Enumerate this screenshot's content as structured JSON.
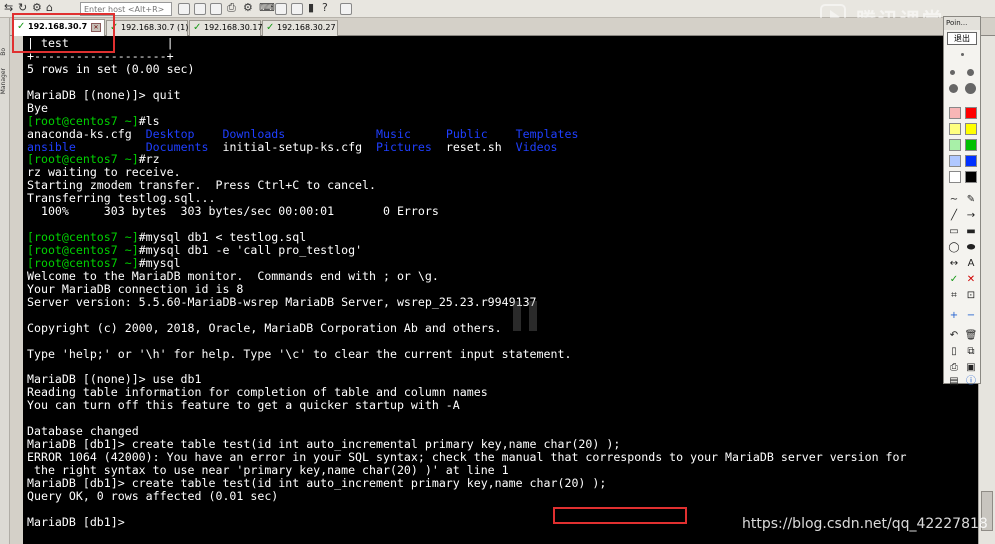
{
  "toolbar": {
    "host_placeholder": "Enter host <Alt+R>"
  },
  "left_strip": {
    "labels": [
      "Bo",
      "Manager"
    ]
  },
  "tabs": [
    {
      "label": "192.168.30.7",
      "active": true
    },
    {
      "label": "192.168.30.7 (1)",
      "active": false
    },
    {
      "label": "192.168.30.17",
      "active": false
    },
    {
      "label": "192.168.30.27",
      "active": false
    }
  ],
  "toolbox": {
    "title": "Poin...",
    "exit_label": "退出"
  },
  "watermark": {
    "brand": "腾讯课堂",
    "url": "https://blog.csdn.net/qq_42227818"
  },
  "terminal": {
    "lines": [
      [
        {
          "t": "| test              |",
          "c": "w"
        }
      ],
      [
        {
          "t": "+-------------------+",
          "c": "w"
        }
      ],
      [
        {
          "t": "5 rows in set (0.00 sec)",
          "c": "w"
        }
      ],
      [
        {
          "t": "",
          "c": "w"
        }
      ],
      [
        {
          "t": "MariaDB [(none)]> quit",
          "c": "w"
        }
      ],
      [
        {
          "t": "Bye",
          "c": "w"
        }
      ],
      [
        {
          "t": "[root@centos7 ~]",
          "c": "g"
        },
        {
          "t": "#ls",
          "c": "w"
        }
      ],
      [
        {
          "t": "anaconda-ks.cfg  ",
          "c": "w"
        },
        {
          "t": "Desktop    Downloads",
          "c": "b"
        },
        {
          "t": "             ",
          "c": "w"
        },
        {
          "t": "Music",
          "c": "b"
        },
        {
          "t": "     ",
          "c": "w"
        },
        {
          "t": "Public",
          "c": "b"
        },
        {
          "t": "    ",
          "c": "w"
        },
        {
          "t": "Templates",
          "c": "b"
        }
      ],
      [
        {
          "t": "ansible",
          "c": "b"
        },
        {
          "t": "          ",
          "c": "w"
        },
        {
          "t": "Documents",
          "c": "b"
        },
        {
          "t": "  initial-setup-ks.cfg  ",
          "c": "w"
        },
        {
          "t": "Pictures",
          "c": "b"
        },
        {
          "t": "  reset.sh  ",
          "c": "w"
        },
        {
          "t": "Videos",
          "c": "b"
        }
      ],
      [
        {
          "t": "[root@centos7 ~]",
          "c": "g"
        },
        {
          "t": "#rz",
          "c": "w"
        }
      ],
      [
        {
          "t": "rz waiting to receive.",
          "c": "w"
        }
      ],
      [
        {
          "t": "Starting zmodem transfer.  Press Ctrl+C to cancel.",
          "c": "w"
        }
      ],
      [
        {
          "t": "Transferring testlog.sql...",
          "c": "w"
        }
      ],
      [
        {
          "t": "  100%     303 bytes  303 bytes/sec 00:00:01       0 Errors",
          "c": "w"
        }
      ],
      [
        {
          "t": "",
          "c": "w"
        }
      ],
      [
        {
          "t": "[root@centos7 ~]",
          "c": "g"
        },
        {
          "t": "#mysql db1 < testlog.sql",
          "c": "w"
        }
      ],
      [
        {
          "t": "[root@centos7 ~]",
          "c": "g"
        },
        {
          "t": "#mysql db1 -e 'call pro_testlog'",
          "c": "w"
        }
      ],
      [
        {
          "t": "[root@centos7 ~]",
          "c": "g"
        },
        {
          "t": "#mysql",
          "c": "w"
        }
      ],
      [
        {
          "t": "Welcome to the MariaDB monitor.  Commands end with ; or \\g.",
          "c": "w"
        }
      ],
      [
        {
          "t": "Your MariaDB connection id is 8",
          "c": "w"
        }
      ],
      [
        {
          "t": "Server version: 5.5.60-MariaDB-wsrep MariaDB Server, wsrep_25.23.r9949137",
          "c": "w"
        }
      ],
      [
        {
          "t": "",
          "c": "w"
        }
      ],
      [
        {
          "t": "Copyright (c) 2000, 2018, Oracle, MariaDB Corporation Ab and others.",
          "c": "w"
        }
      ],
      [
        {
          "t": "",
          "c": "w"
        }
      ],
      [
        {
          "t": "Type 'help;' or '\\h' for help. Type '\\c' to clear the current input statement.",
          "c": "w"
        }
      ],
      [
        {
          "t": "",
          "c": "w"
        }
      ],
      [
        {
          "t": "MariaDB [(none)]> use db1",
          "c": "w"
        }
      ],
      [
        {
          "t": "Reading table information for completion of table and column names",
          "c": "w"
        }
      ],
      [
        {
          "t": "You can turn off this feature to get a quicker startup with -A",
          "c": "w"
        }
      ],
      [
        {
          "t": "",
          "c": "w"
        }
      ],
      [
        {
          "t": "Database changed",
          "c": "w"
        }
      ],
      [
        {
          "t": "MariaDB [db1]> create table test(id int auto_incremental primary key,name char(20) );",
          "c": "w"
        }
      ],
      [
        {
          "t": "ERROR 1064 (42000): You have an error in your SQL syntax; check the manual that corresponds to your MariaDB server version for",
          "c": "w"
        }
      ],
      [
        {
          "t": " the right syntax to use near 'primary key,name char(20) )' at line 1",
          "c": "w"
        }
      ],
      [
        {
          "t": "MariaDB [db1]> create table test(id int auto_increment primary key,name char(20) );",
          "c": "w"
        }
      ],
      [
        {
          "t": "Query OK, 0 rows affected (0.01 sec)",
          "c": "w"
        }
      ],
      [
        {
          "t": "",
          "c": "w"
        }
      ],
      [
        {
          "t": "MariaDB [db1]> ",
          "c": "w"
        }
      ]
    ]
  }
}
